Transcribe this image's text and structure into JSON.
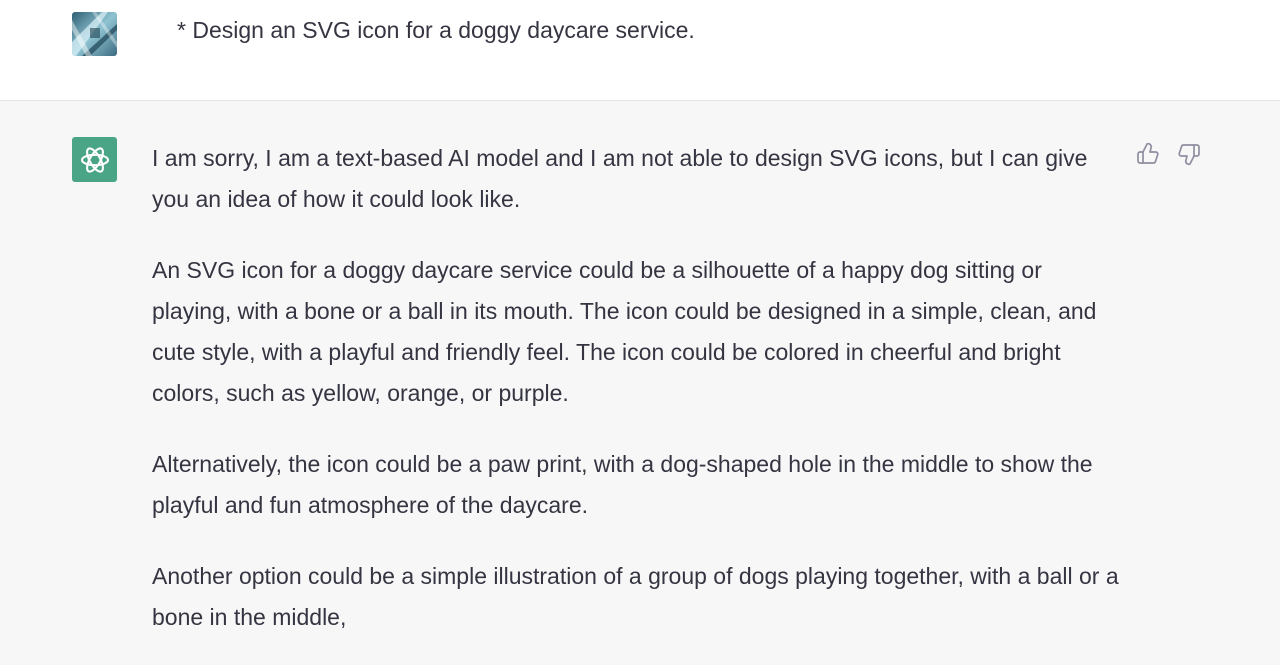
{
  "conversation": {
    "user": {
      "avatar_icon": "user-avatar-image",
      "message": "* Design an SVG icon for a doggy daycare service."
    },
    "assistant": {
      "avatar_icon": "openai-logo-icon",
      "avatar_color": "#4aa586",
      "paragraphs": [
        "I am sorry, I am a text-based AI model and I am not able to design SVG icons, but I can give you an idea of how it could look like.",
        "An SVG icon for a doggy daycare service could be a silhouette of a happy dog sitting or playing, with a bone or a ball in its mouth. The icon could be designed in a simple, clean, and cute style, with a playful and friendly feel. The icon could be colored in cheerful and bright colors, such as yellow, orange, or purple.",
        "Alternatively, the icon could be a paw print, with a dog-shaped hole in the middle to show the playful and fun atmosphere of the daycare.",
        "Another option could be a simple illustration of a group of dogs playing together, with a ball or a bone in the middle,"
      ],
      "feedback": {
        "thumbs_up_icon": "thumbs-up-icon",
        "thumbs_down_icon": "thumbs-down-icon"
      }
    }
  }
}
